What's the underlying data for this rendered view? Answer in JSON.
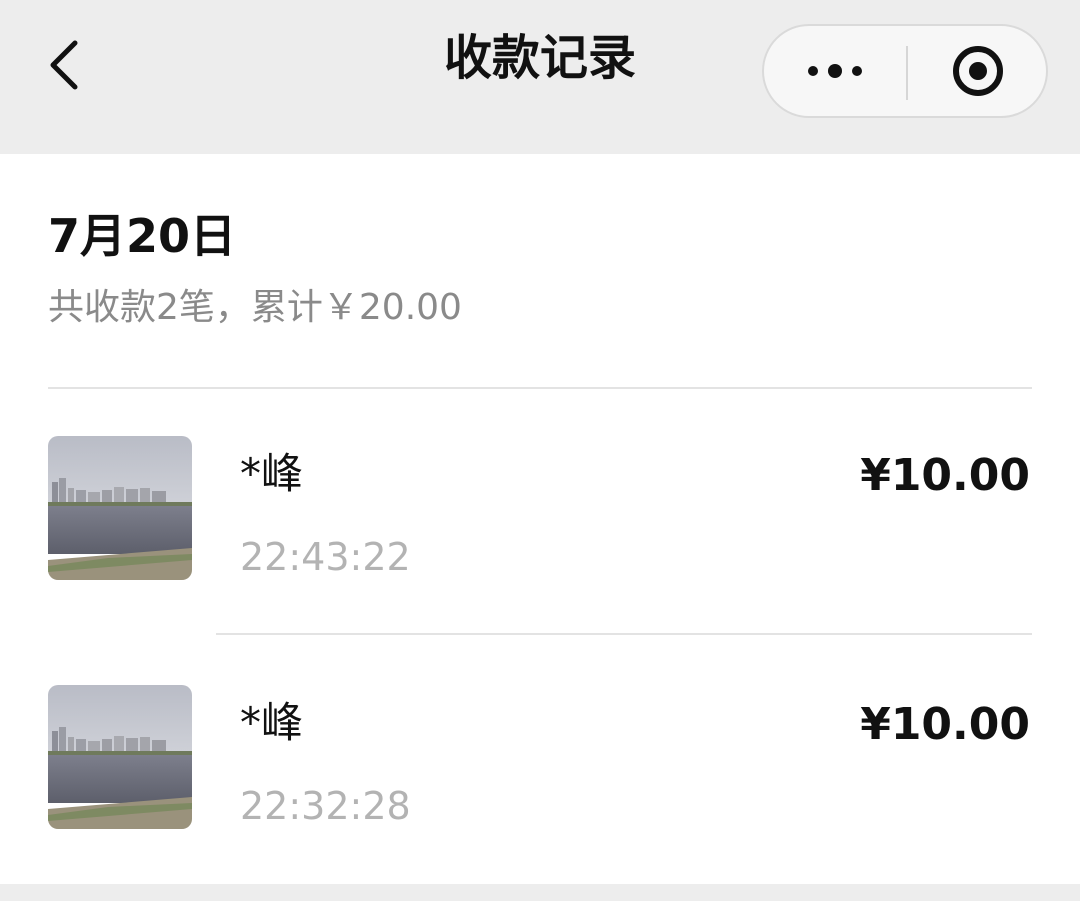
{
  "nav": {
    "title": "收款记录",
    "back_icon": "chevron-left-icon",
    "more_icon": "more-dots-icon",
    "close_icon": "target-close-icon"
  },
  "day": {
    "date": "7月20日",
    "summary": "共收款2笔，累计￥20.00"
  },
  "records": [
    {
      "payer": "*峰",
      "time": "22:43:22",
      "amount": "¥10.00",
      "avatar": "lake-photo-avatar"
    },
    {
      "payer": "*峰",
      "time": "22:32:28",
      "amount": "¥10.00",
      "avatar": "lake-photo-avatar"
    }
  ],
  "colors": {
    "navbar_bg": "#ededed",
    "text_primary": "#111111",
    "text_secondary": "#8a8a8a",
    "text_time": "#b3b3b3"
  }
}
